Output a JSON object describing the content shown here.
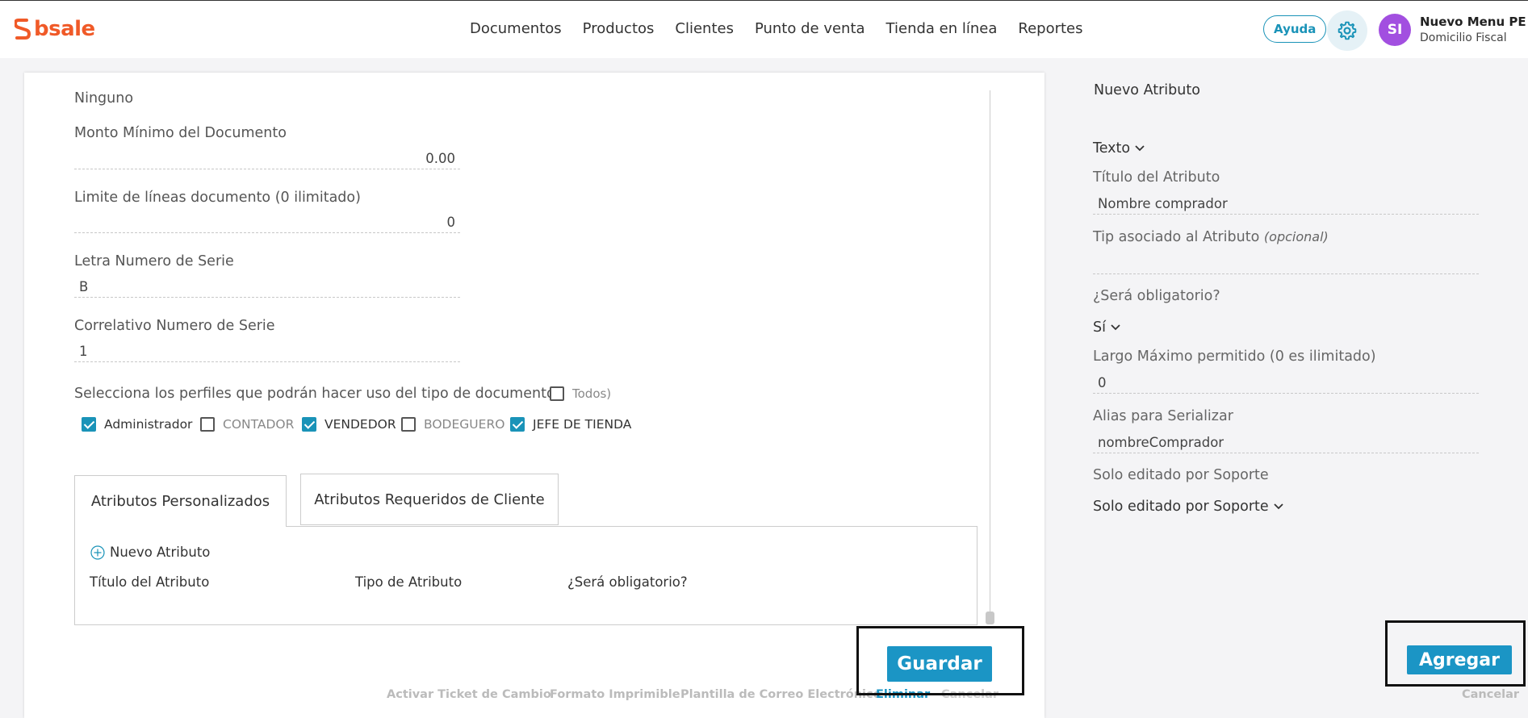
{
  "header": {
    "logo_text": "bsale",
    "nav": [
      "Documentos",
      "Productos",
      "Clientes",
      "Punto de venta",
      "Tienda en línea",
      "Reportes"
    ],
    "help_label": "Ayuda",
    "avatar_initials": "SI",
    "user_name": "Nuevo Menu PE",
    "user_sub": "Domicilio Fiscal"
  },
  "form": {
    "none_text": "Ninguno",
    "min_amount": {
      "label": "Monto Mínimo del Documento",
      "value": "0.00"
    },
    "line_limit": {
      "label": "Limite de líneas documento (0 ilimitado)",
      "value": "0"
    },
    "series_letter": {
      "label": "Letra Numero de Serie",
      "value": "B"
    },
    "series_correlative": {
      "label": "Correlativo Numero de Serie",
      "value": "1"
    },
    "profiles_label": "Selecciona los perfiles que podrán hacer uso del tipo de documento (",
    "all_label": "Todos)",
    "profiles": [
      {
        "label": "Administrador",
        "checked": true
      },
      {
        "label": "CONTADOR",
        "checked": false
      },
      {
        "label": "VENDEDOR",
        "checked": true
      },
      {
        "label": "BODEGUERO",
        "checked": false
      },
      {
        "label": "JEFE DE TIENDA",
        "checked": true
      }
    ]
  },
  "tabs": [
    "Atributos Personalizados",
    "Atributos Requeridos de Cliente"
  ],
  "attributes": {
    "new_label": "Nuevo Atributo",
    "columns": [
      "Título del Atributo",
      "Tipo de Atributo",
      "¿Será obligatorio?"
    ]
  },
  "footer": {
    "save_label": "Guardar",
    "links": [
      "Activar Ticket de Cambio",
      "Formato Imprimible",
      "Plantilla de Correo Electrónico",
      "Eliminar",
      "Cancelar"
    ]
  },
  "right": {
    "title": "Nuevo Atributo",
    "type_value": "Texto",
    "attr_title_label": "Título del Atributo",
    "attr_title_value": "Nombre comprador",
    "tip_label": "Tip asociado al Atributo",
    "tip_optional": "(opcional)",
    "tip_value": "",
    "required_label": "¿Será obligatorio?",
    "required_value": "Sí",
    "max_length_label": "Largo Máximo permitido (0 es ilimitado)",
    "max_length_value": "0",
    "alias_label": "Alias para Serializar",
    "alias_value": "nombreComprador",
    "support_label": "Solo editado por Soporte",
    "support_value": "Solo editado por Soporte",
    "add_label": "Agregar",
    "cancel_label": "Cancelar"
  },
  "colors": {
    "brand": "#f05a28",
    "accent": "#1b95c5",
    "avatar": "#a24fe0"
  }
}
